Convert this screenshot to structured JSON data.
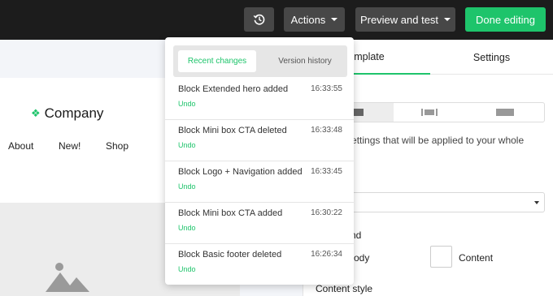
{
  "toolbar": {
    "history_icon": "history-icon",
    "actions_label": "Actions",
    "preview_label": "Preview and test",
    "done_label": "Done editing",
    "accent_color": "#1ec46b"
  },
  "canvas": {
    "logo_text": "Company",
    "nav": [
      "About",
      "New!",
      "Shop"
    ],
    "image_icon": "image-placeholder-icon"
  },
  "panel": {
    "tabs": [
      "emplate",
      "Settings"
    ],
    "description": "fault settings that will be applied to your whole\nr.",
    "background_label": "nd",
    "body_label": "ody",
    "content_label": "Content",
    "content_style_label": "Content style"
  },
  "history": {
    "tabs": {
      "recent": "Recent changes",
      "versions": "Version history"
    },
    "undo_label": "Undo",
    "items": [
      {
        "title": "Block Extended hero added",
        "time": "16:33:55"
      },
      {
        "title": "Block Mini box CTA deleted",
        "time": "16:33:48"
      },
      {
        "title": "Block Logo + Navigation added",
        "time": "16:33:45"
      },
      {
        "title": "Block Mini box CTA added",
        "time": "16:30:22"
      },
      {
        "title": "Block Basic footer deleted",
        "time": "16:26:34"
      }
    ]
  }
}
